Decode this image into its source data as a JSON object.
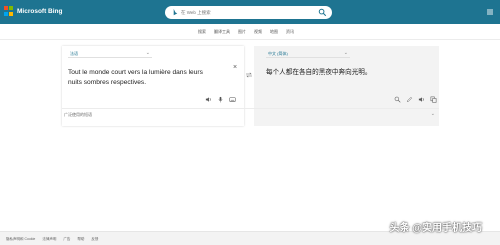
{
  "header": {
    "brand": "Microsoft Bing",
    "search_placeholder": "在 Web 上搜索",
    "logo_colors": [
      "#f25022",
      "#7fba00",
      "#00a4ef",
      "#ffb900"
    ],
    "accent": "#1e7491"
  },
  "nav": {
    "items": [
      "搜索",
      "翻译工具",
      "图片",
      "视频",
      "地图",
      "资讯"
    ]
  },
  "translator": {
    "source_lang": "法语",
    "target_lang": "中文 (简体)",
    "source_text": "Tout le monde court vers la lumière dans leurs nuits sombres respectives.",
    "target_text": "每个人都在各自的黑夜中奔向光明。",
    "status": "广泛使用的短语"
  },
  "footer": {
    "links": [
      "隐私声明和 Cookie",
      "法律声明",
      "广告",
      "帮助",
      "反馈"
    ]
  },
  "watermark": "头条 @实用手机技巧"
}
